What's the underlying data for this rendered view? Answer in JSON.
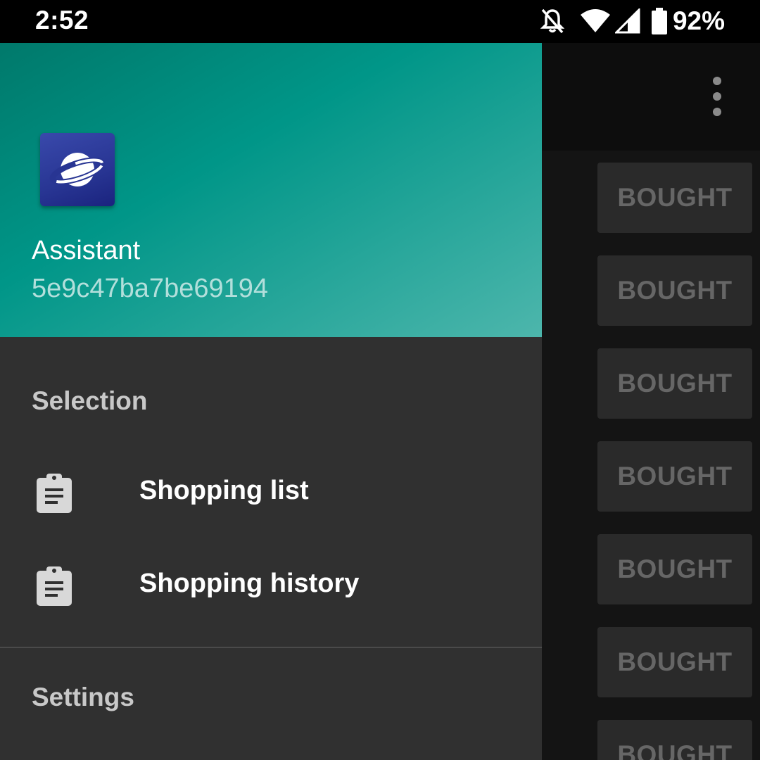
{
  "status_bar": {
    "time": "2:52",
    "battery_percent": "92%",
    "icons": [
      "notifications-off-icon",
      "wifi-icon",
      "cell-signal-icon",
      "battery-icon"
    ]
  },
  "app": {
    "overflow_icon": "more-vert-icon",
    "bought_buttons": [
      "BOUGHT",
      "BOUGHT",
      "BOUGHT",
      "BOUGHT",
      "BOUGHT",
      "BOUGHT",
      "BOUGHT"
    ]
  },
  "drawer": {
    "header": {
      "logo_icon": "planet-icon",
      "name": "Assistant",
      "id": "5e9c47ba7be69194"
    },
    "sections": [
      {
        "label": "Selection",
        "items": [
          {
            "label": "Shopping list",
            "icon": "clipboard-icon"
          },
          {
            "label": "Shopping history",
            "icon": "clipboard-icon"
          }
        ]
      },
      {
        "label": "Settings",
        "items": []
      }
    ]
  },
  "colors": {
    "header_gradient_start": "#00796b",
    "header_gradient_end": "#4db6ac",
    "drawer_bg": "#303030",
    "app_bg": "#141414",
    "button_bg": "#2a2a2a",
    "button_text": "#666666"
  }
}
